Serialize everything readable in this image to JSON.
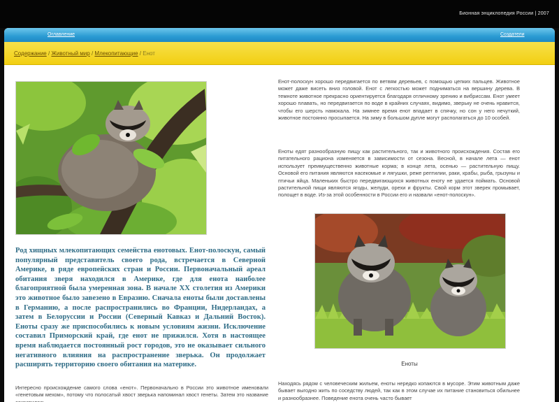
{
  "header": {
    "site_credit": "Бионная энциклопедия России | 2007"
  },
  "nav": {
    "home": "Оглавление",
    "contact": "Создатели"
  },
  "breadcrumb": {
    "items": [
      "Содержание",
      "Животный мир",
      "Млекопитающие"
    ],
    "separator": "/",
    "current": "Енот"
  },
  "article": {
    "lead": "Род хищных млекопитающих семейства енотовых. Енот-полоскун, самый популярный представитель своего рода, встречается в Северной Америке, в ряде европейских стран и России. Первоначальный ареал обитания зверя находился в Америке, где для енота наиболее благоприятной была умеренная зона. В начале XX столетия из Америки это животное было завезено в Евразию. Сначала еноты были доставлены в Германию, а после распространились во Франции, Нидерландах, а затем в Белоруссии и России (Северный Кавказ и Дальний Восток). Еноты сразу же приспособились к новым условиям жизни. Исключение составил Приморский край, где енот не прижился. Хотя в настоящее время наблюдается постоянный рост городов, это не оказывает сильного негативного влияния на распространение зверька. Он продолжает расширять территорию своего обитания на материке.",
    "para_climb": "Енот-полоскун хорошо передвигается по ветвям деревьев, с помощью цепких пальцев. Животное может даже висеть вниз головой. Енот с легкостью может подниматься на вершину дерева. В темноте животное прекрасно ориентируется благодаря отличному зрению и вибриссам. Енот умеет хорошо плавать, но передвигается по воде в крайних случаях, видимо, зверьку не очень нравится, чтобы его шерсть намокала. На зимнее время енот впадает в спячку, но сон у него нечуткий, животное постоянно просыпается. На зиму в большом дупле могут располагаться до 10 особей.",
    "para_food": "Еноты едят разнообразную пищу как растительного, так и животного происхождения. Состав его питательного рациона изменяется в зависимости от сезона. Весной, в начале лета — енот использует преимущественно животные корма; в конце лета, осенью — растительную пищу. Основой его питания являются насекомые и лягушки, реже рептилии, раки, крабы, рыба, грызуны и птичьи яйца. Маленьких быстро передвигающихся животных еноту не удается поймать. Основой растительной пищи являются ягоды, желуди, орехи и фрукты. Свой корм этот зверек промывает, полощет в воде. Из-за этой особенности в России его и назвали «енот-полоскун».",
    "para_name": "Интересно происхождение самого слова «енот». Первоначально в России это животное именовали «генетовым мехом», потому что полосатый хвост зверька напоминал хвост генеты. Затем это название сократилось.",
    "para_city": "Находясь рядом с человеческим жильем, еноты нередко копаются в мусоре. Этим животным даже бывает выгодно жить по соседству людей, так как в этом случае их питание становиться обильнее и разнообразнее. Поведение енота очень часто бывает",
    "caption": "Еноты"
  },
  "icons": {
    "tree_photo": "raccoon-in-tree-photo",
    "pair_photo": "two-raccoons-photo"
  },
  "colors": {
    "nav_blue": "#2b9bd3",
    "crumb_yellow": "#f2cf12",
    "lead_text": "#2f6c86"
  }
}
